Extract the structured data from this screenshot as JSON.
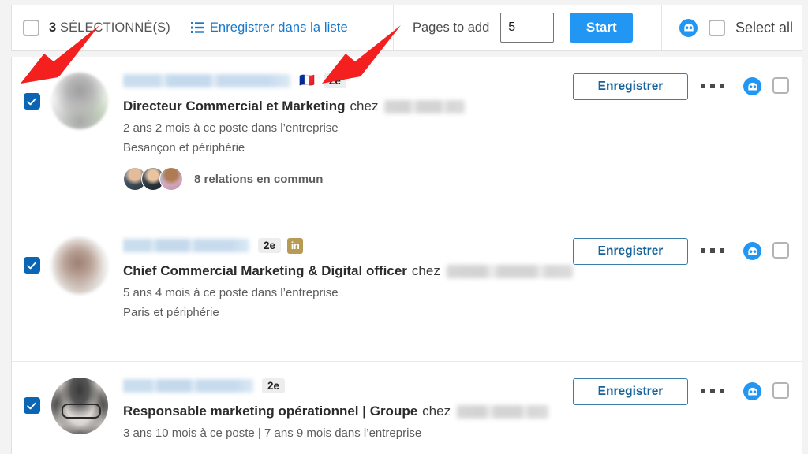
{
  "toolbar": {
    "select_checkbox_name": "select-all-header",
    "selected_count_number": "3",
    "selected_count_label": " SÉLECTIONNÉ(S)",
    "save_to_list_label": "Enregistrer dans la liste",
    "pages_to_add_label": "Pages to add",
    "pages_to_add_value": "5",
    "start_label": "Start",
    "select_all_label": "Select all",
    "accent_blue": "#2196f3",
    "link_blue": "#1878c9"
  },
  "rows": [
    {
      "checked": true,
      "flag": "🇫🇷",
      "degree_badge": "2e",
      "has_linkedin_badge": false,
      "title": "Directeur Commercial et Marketing",
      "chez": "chez",
      "meta1": "2 ans 2 mois à ce poste dans l’entreprise",
      "meta2": "Besançon et périphérie",
      "mutual": "8 relations en commun",
      "save_label": "Enregistrer"
    },
    {
      "checked": true,
      "flag": "",
      "degree_badge": "2e",
      "has_linkedin_badge": true,
      "linkedin_badge": "in",
      "title": "Chief Commercial Marketing & Digital officer",
      "chez": "chez",
      "meta1": "5 ans 4 mois à ce poste dans l’entreprise",
      "meta2": "Paris et périphérie",
      "mutual": "",
      "save_label": "Enregistrer"
    },
    {
      "checked": true,
      "flag": "",
      "degree_badge": "2e",
      "has_linkedin_badge": false,
      "title": "Responsable marketing opérationnel | Groupe",
      "chez": "chez",
      "meta1": "3 ans 10 mois à ce poste  | 7 ans 9 mois dans l’entreprise",
      "meta2": "",
      "mutual": "",
      "save_label": "Enregistrer"
    }
  ],
  "annotations": {
    "arrow_color": "#f42020",
    "arrow1_target": "selected-count",
    "arrow2_target": "save-to-list-link"
  }
}
